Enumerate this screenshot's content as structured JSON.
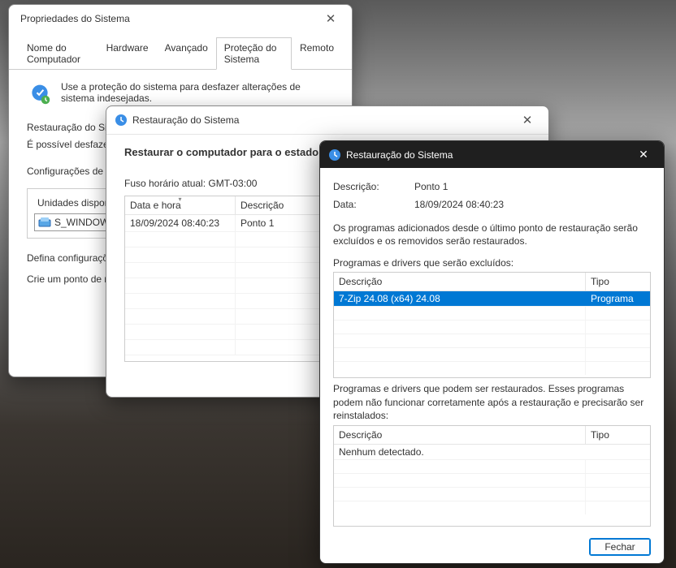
{
  "win1": {
    "title": "Propriedades do Sistema",
    "tabs": [
      "Nome do Computador",
      "Hardware",
      "Avançado",
      "Proteção do Sistema",
      "Remoto"
    ],
    "active_tab_index": 3,
    "info_text": "Use a proteção do sistema para desfazer alterações de sistema indesejadas.",
    "section1_title": "Restauração do Siste",
    "section1_desc": "É possível desfazer a revertendo seu comp de restauração anter",
    "section2_title": "Configurações de Pro",
    "drives_label": "Unidades disponi",
    "drive_name": "S_WINDOWS",
    "footer1": "Defina configuraçõe espaço em disco e restauração.",
    "footer2": "Crie um ponto de re unidades com prote"
  },
  "win2": {
    "title": "Restauração do Sistema",
    "heading": "Restaurar o computador para o estado que",
    "tz": "Fuso horário atual: GMT-03:00",
    "col_date": "Data e hora",
    "col_desc": "Descrição",
    "rows": [
      {
        "date": "18/09/2024 08:40:23",
        "desc": "Ponto 1"
      }
    ]
  },
  "win3": {
    "title": "Restauração do Sistema",
    "desc_label": "Descrição:",
    "desc_value": "Ponto 1",
    "date_label": "Data:",
    "date_value": "18/09/2024 08:40:23",
    "note": "Os programas adicionados desde o último ponto de restauração serão excluídos e os removidos serão restaurados.",
    "excluded_heading": "Programas e drivers que serão excluídos:",
    "col_desc": "Descrição",
    "col_type": "Tipo",
    "excluded_rows": [
      {
        "desc": "7-Zip 24.08 (x64) 24.08",
        "type": "Programa"
      }
    ],
    "restorable_heading": "Programas e drivers que podem ser restaurados. Esses programas podem não funcionar corretamente após a restauração e precisarão ser reinstalados:",
    "none_detected": "Nenhum detectado.",
    "close_btn": "Fechar"
  }
}
